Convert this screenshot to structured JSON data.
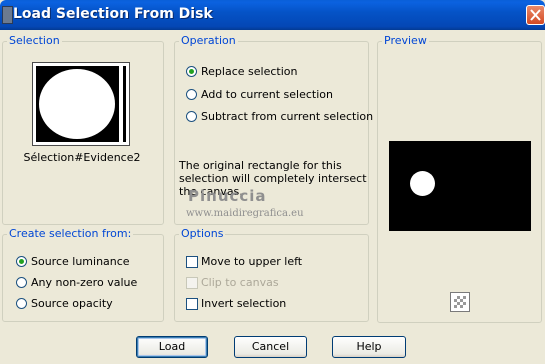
{
  "window": {
    "title": "Load Selection From Disk",
    "app_icon": "paint-shop-pro-icon",
    "close_icon": "close-x-icon"
  },
  "selection": {
    "legend": "Selection",
    "thumbnail_label": "Sélection#Evidence2"
  },
  "operation": {
    "legend": "Operation",
    "options": [
      "Replace selection",
      "Add to current selection",
      "Subtract from current selection"
    ],
    "selected": "Replace selection",
    "info": "The original rectangle for this selection will completely intersect the canvas."
  },
  "preview": {
    "legend": "Preview",
    "toggle_icon": "checkerboard-icon"
  },
  "create_from": {
    "legend": "Create selection from:",
    "options": [
      "Source luminance",
      "Any non-zero value",
      "Source opacity"
    ],
    "selected": "Source luminance"
  },
  "options": {
    "legend": "Options",
    "items": [
      {
        "label": "Move to upper left",
        "checked": false,
        "enabled": true
      },
      {
        "label": "Clip to canvas",
        "checked": false,
        "enabled": false
      },
      {
        "label": "Invert selection",
        "checked": false,
        "enabled": true
      }
    ]
  },
  "watermark": {
    "name": "Pinuccia",
    "url": "www.maidiregrafica.eu"
  },
  "buttons": {
    "load": "Load",
    "cancel": "Cancel",
    "help": "Help"
  }
}
